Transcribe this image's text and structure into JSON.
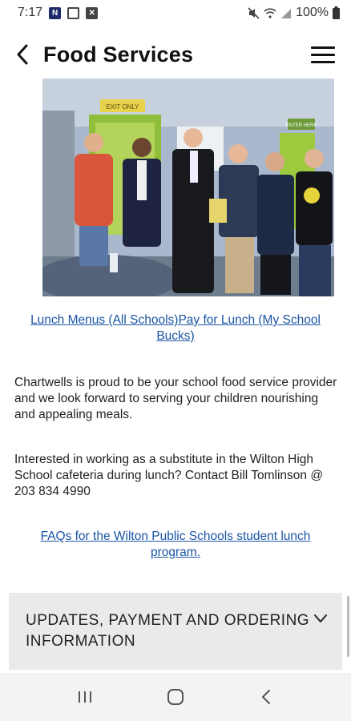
{
  "status_bar": {
    "time": "7:17",
    "battery": "100%",
    "icons": [
      "app-badge-icon",
      "photo-icon",
      "x-notification-icon",
      "mute-icon",
      "wifi-icon",
      "signal-icon",
      "battery-icon"
    ],
    "app_badge_letter": "N",
    "x_letter": "✕"
  },
  "header": {
    "title": "Food Services",
    "back_icon": "chevron-left-icon",
    "menu_icon": "hamburger-menu-icon"
  },
  "photo": {
    "signs": [
      "EXIT ONLY",
      "ENTER HERE"
    ]
  },
  "links": {
    "lunch_menus": "Lunch Menus (All Schools)",
    "pay_for_lunch": "Pay for Lunch (My School Bucks)",
    "faqs": "FAQs for the Wilton Public Schools student lunch program."
  },
  "paragraphs": {
    "chartwells": "Chartwells is proud to be your school food service provider and we look forward to serving your children nourishing and appealing meals.",
    "substitute": "Interested in working as a substitute in the Wilton High School cafeteria during lunch? Contact Bill Tomlinson @ 203 834 4990"
  },
  "accordion": {
    "title": "UPDATES, PAYMENT AND ORDERING INFORMATION",
    "expanded": false
  },
  "nav_bar": {
    "buttons": [
      "recent-apps-icon",
      "home-icon",
      "back-icon"
    ]
  },
  "colors": {
    "link": "#1a55a6",
    "accordion_bg": "#eaeaea",
    "nav_bg": "#f3f3f3"
  }
}
